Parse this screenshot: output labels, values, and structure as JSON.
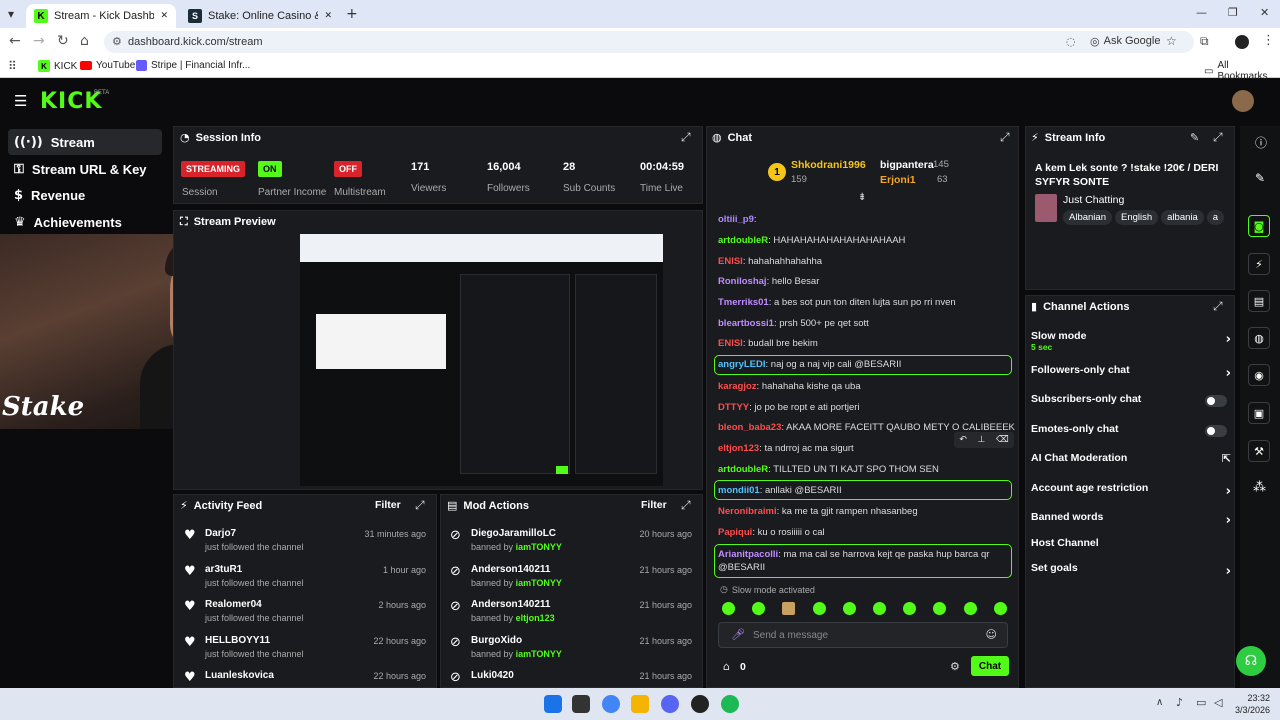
{
  "browser": {
    "tabs": [
      {
        "label": "Stream - Kick Dashboard",
        "icon": "kick-icon"
      },
      {
        "label": "Stake: Online Casino & Sports B",
        "icon": "stake-icon"
      }
    ],
    "url": "dashboard.kick.com/stream",
    "ask_google": "Ask Google",
    "bookmarks": [
      "KICK",
      "YouTube",
      "Stripe | Financial Infr..."
    ],
    "all_bookmarks": "All Bookmarks"
  },
  "brand": {
    "logo": "KICK",
    "beta": "BETA"
  },
  "sidebar": {
    "items": [
      {
        "label": "Stream",
        "icon": "broadcast-icon"
      },
      {
        "label": "Stream URL & Key",
        "icon": "key-icon"
      },
      {
        "label": "Revenue",
        "icon": "dollar-icon"
      },
      {
        "label": "Achievements",
        "icon": "trophy-icon"
      }
    ]
  },
  "session": {
    "title": "Session Info",
    "stats": [
      {
        "value": "STREAMING",
        "label": "Session"
      },
      {
        "value": "ON",
        "label": "Partner Income"
      },
      {
        "value": "OFF",
        "label": "Multistream"
      },
      {
        "value": "171",
        "label": "Viewers"
      },
      {
        "value": "16,004",
        "label": "Followers"
      },
      {
        "value": "28",
        "label": "Sub Counts"
      },
      {
        "value": "00:04:59",
        "label": "Time Live"
      }
    ]
  },
  "preview": {
    "title": "Stream Preview",
    "overlay": "Stake"
  },
  "activity": {
    "title": "Activity Feed",
    "filter": "Filter",
    "items": [
      {
        "user": "Darjo7",
        "text": "just followed the channel",
        "ago": "31 minutes ago"
      },
      {
        "user": "ar3tuR1",
        "text": "just followed the channel",
        "ago": "1 hour ago"
      },
      {
        "user": "Realomer04",
        "text": "just followed the channel",
        "ago": "2 hours ago"
      },
      {
        "user": "HELLBOYY11",
        "text": "just followed the channel",
        "ago": "22 hours ago"
      },
      {
        "user": "Luanleskovica",
        "text": "",
        "ago": "22 hours ago"
      }
    ]
  },
  "mod": {
    "title": "Mod Actions",
    "filter": "Filter",
    "items": [
      {
        "user": "DiegoJaramilloLC",
        "prefix": "banned by",
        "by": "iamTONYY",
        "ago": "20 hours ago"
      },
      {
        "user": "Anderson140211",
        "prefix": "banned by",
        "by": "iamTONYY",
        "ago": "21 hours ago"
      },
      {
        "user": "Anderson140211",
        "prefix": "banned by",
        "by": "eltjon123",
        "ago": "21 hours ago"
      },
      {
        "user": "BurgoXido",
        "prefix": "banned by",
        "by": "iamTONYY",
        "ago": "21 hours ago"
      },
      {
        "user": "Luki0420",
        "prefix": "",
        "by": "",
        "ago": "21 hours ago"
      }
    ]
  },
  "chat": {
    "title": "Chat",
    "gifters": [
      {
        "rank": "1",
        "name": "Shkodrani1996",
        "count": "159"
      },
      {
        "name": "bigpantera",
        "count": "145"
      },
      {
        "name": "Erjoni1",
        "count": "63"
      }
    ],
    "messages": [
      {
        "user": "oltiii_p9",
        "text": "",
        "color": "#b388ff"
      },
      {
        "user": "artdoubleR",
        "text": "HAHAHAHAHAHAHAHAHAAH",
        "color": "#53fc18"
      },
      {
        "user": "ENISI",
        "text": "hahahahhahahha",
        "color": "#ff4d4d"
      },
      {
        "user": "Roniloshaj",
        "text": "hello Besar",
        "color": "#c08cff"
      },
      {
        "user": "Tmerriks01",
        "text": "a bes sot pun ton diten lujta sun po rri nven",
        "color": "#c08cff"
      },
      {
        "user": "bleartbossi1",
        "text": "prsh 500+ pe qet sott",
        "color": "#c08cff"
      },
      {
        "user": "ENISI",
        "text": "budall bre bekim",
        "color": "#ff4d4d"
      },
      {
        "user": "angryLEDI",
        "text": "naj og a naj vip cali @BESARII",
        "color": "#4fc3ff"
      },
      {
        "user": "karagjoz",
        "text": "hahahaha kishe qa uba",
        "color": "#ff4d4d"
      },
      {
        "user": "DTTYY",
        "text": "jo po be ropt e ati portjeri",
        "color": "#ff4d4d"
      },
      {
        "user": "bleon_baba23",
        "text": "AKAA MORE FACEITT QAUBO METY O CALIBEEEK",
        "color": "#ff4d4d"
      },
      {
        "user": "eltjon123",
        "text": "ta ndrroj ac ma sigurt",
        "color": "#ff4d4d"
      },
      {
        "user": "artdoubleR",
        "text": "TILLTED UN TI KAJT SPO THOM SEN",
        "color": "#53fc18"
      },
      {
        "user": "mondii01",
        "text": "anllaki @BESARII",
        "color": "#4fc3ff"
      },
      {
        "user": "Neronibraimi",
        "text": "ka me ta gjit rampen nhasanbeg",
        "color": "#ff4d4d"
      },
      {
        "user": "Papiqui",
        "text": "ku o rosiiiii o cal",
        "color": "#ff4d4d"
      },
      {
        "user": "Arianitpacolli",
        "text": "ma ma cal se harrova kejt qe paska hup barca qr @BESARII",
        "color": "#c08cff"
      }
    ],
    "slow_mode_notice": "Slow mode activated",
    "input_placeholder": "Send a message",
    "points": "0",
    "send_label": "Chat"
  },
  "stream_info": {
    "title": "Stream Info",
    "stream_title": "A kem Lek sonte ? !stake !20€ / DERI SYFYR SONTE",
    "category": "Just Chatting",
    "tags": [
      "Albanian",
      "English",
      "albania",
      "a"
    ]
  },
  "channel_actions": {
    "title": "Channel Actions",
    "rows": [
      {
        "label": "Slow mode",
        "sub": "5 sec",
        "control": "chevron"
      },
      {
        "label": "Followers-only chat",
        "control": "chevron"
      },
      {
        "label": "Subscribers-only chat",
        "control": "toggle"
      },
      {
        "label": "Emotes-only chat",
        "control": "toggle"
      },
      {
        "label": "AI Chat Moderation",
        "control": "external"
      },
      {
        "label": "Account age restriction",
        "control": "chevron"
      },
      {
        "label": "Banned words",
        "control": "chevron"
      },
      {
        "label": "Host Channel",
        "control": "none"
      },
      {
        "label": "Set goals",
        "control": "chevron"
      }
    ]
  },
  "system": {
    "time": "23:32",
    "date": "3/3/2026"
  },
  "colors": {
    "kick_green": "#53fc18",
    "panel": "#191b1f",
    "streaming_red": "#d9222a"
  }
}
